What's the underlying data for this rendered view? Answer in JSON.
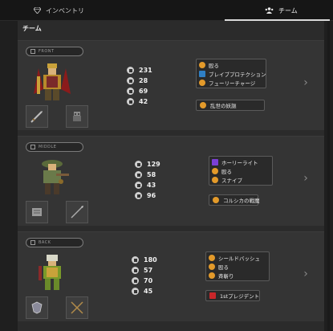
{
  "tabs": {
    "inventory": "インベントリ",
    "team": "チーム"
  },
  "panel_title": "チーム",
  "cards": [
    {
      "position": "FRONT",
      "stats": [
        "231",
        "28",
        "69",
        "42"
      ],
      "skills": [
        {
          "icon": "orange",
          "label": "殴る"
        },
        {
          "icon": "blue",
          "label": "ブレイブプロテクション"
        },
        {
          "icon": "orange",
          "label": "フューリーチャージ"
        }
      ],
      "ability": {
        "icon": "orange",
        "label": "乱世の妖謳"
      }
    },
    {
      "position": "MIDDLE",
      "stats": [
        "129",
        "58",
        "43",
        "96"
      ],
      "skills": [
        {
          "icon": "purple",
          "label": "ホーリーライト"
        },
        {
          "icon": "orange",
          "label": "殴る"
        },
        {
          "icon": "orange",
          "label": "スナイプ"
        }
      ],
      "ability": {
        "icon": "orange",
        "label": "コルシカの戦魔"
      }
    },
    {
      "position": "BACK",
      "stats": [
        "180",
        "57",
        "70",
        "45"
      ],
      "skills": [
        {
          "icon": "orange",
          "label": "シールドバッシュ"
        },
        {
          "icon": "orange",
          "label": "殴る"
        },
        {
          "icon": "orange",
          "label": "斉斬り"
        }
      ],
      "ability": {
        "icon": "red",
        "label": "1stプレジデント"
      }
    }
  ],
  "colors": {
    "skill_orange": "#e39a2a",
    "skill_blue": "#2f7fc4",
    "skill_purple": "#7b3fd6",
    "skill_red": "#c8262a"
  }
}
